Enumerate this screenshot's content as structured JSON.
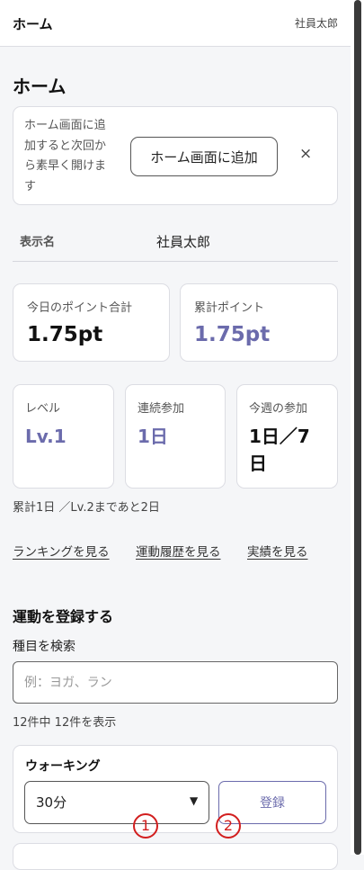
{
  "header": {
    "title": "ホーム",
    "user_name": "社員太郎"
  },
  "page": {
    "title": "ホーム"
  },
  "install_prompt": {
    "text_lines": [
      "ホーム画面に追",
      "加すると次回か",
      "ら素早く開けま",
      "す"
    ],
    "button_label": "ホーム画面に追加",
    "close_icon": "×"
  },
  "profile": {
    "display_name_label": "表示名",
    "display_name": "社員太郎"
  },
  "points": {
    "today_label": "今日のポイント合計",
    "today_value": "1.75pt",
    "total_label": "累計ポイント",
    "total_value": "1.75pt"
  },
  "stats": {
    "level_label": "レベル",
    "level_value": "Lv.1",
    "streak_label": "連続参加",
    "streak_value": "1日",
    "week_label": "今週の参加",
    "week_value": "1日／7日"
  },
  "progress_note": "累計1日 ／Lv.2まであと2日",
  "links": {
    "ranking": "ランキングを見る",
    "history": "運動履歴を見る",
    "achievements": "実績を見る"
  },
  "register": {
    "title": "運動を登録する",
    "search_label": "種目を検索",
    "search_placeholder": "例：ヨガ、ラン",
    "search_value": "",
    "result_count": "12件中 12件を表示"
  },
  "activities": [
    {
      "name": "ウォーキング",
      "duration": "30分",
      "register_label": "登録"
    }
  ],
  "annotations": {
    "marker_1": "1",
    "marker_2": "2"
  },
  "colors": {
    "accent": "#6b6bac",
    "marker": "#d21e1e",
    "background": "#f5f6f8"
  },
  "icons": {
    "close": "close-icon",
    "select": "chevron-down-icon"
  }
}
